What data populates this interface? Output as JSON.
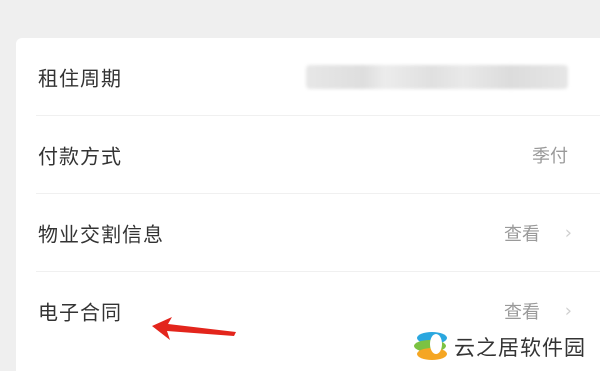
{
  "rows": [
    {
      "label": "租住周期",
      "value": "",
      "blurred": true
    },
    {
      "label": "付款方式",
      "value": "季付"
    },
    {
      "label": "物业交割信息",
      "value": "查看"
    },
    {
      "label": "电子合同",
      "value": "查看"
    }
  ],
  "watermark": {
    "text": "云之居软件园"
  },
  "colors": {
    "page_background": "#efefef",
    "card_background": "#ffffff",
    "label_text": "#333333",
    "value_text": "#9a9a9a",
    "annotation_arrow": "#e3251c"
  },
  "icons": {
    "chevron": "chevron-right-icon",
    "annotation": "red-arrow-icon",
    "logo": "yunzhiju-logo-icon"
  }
}
